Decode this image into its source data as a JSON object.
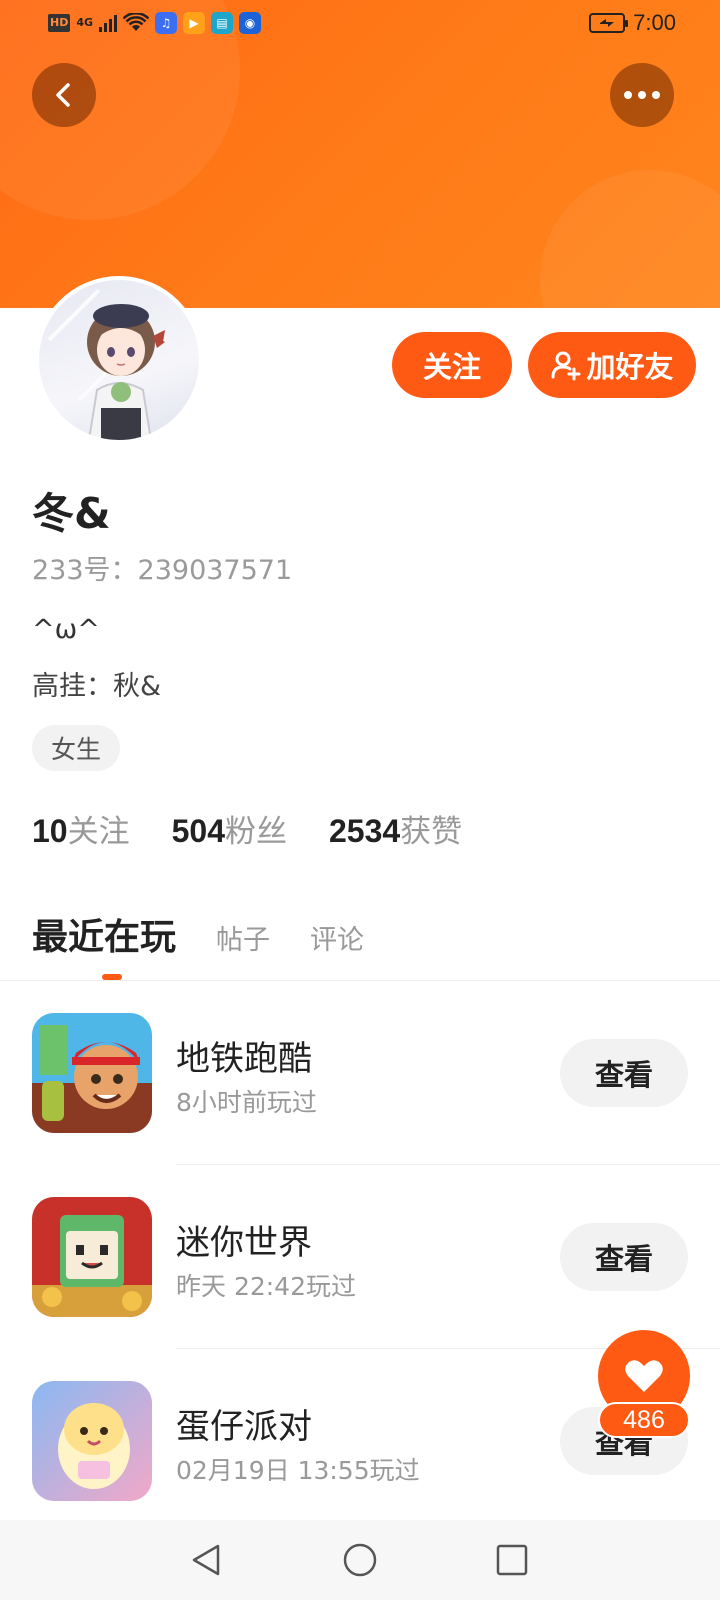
{
  "statusbar": {
    "network": "4G",
    "time": "7:00"
  },
  "profile": {
    "name": "冬&",
    "id_text": "233号：239037571",
    "bio_line1": "^ω^",
    "bio_line2": "高挂：秋&",
    "gender": "女生"
  },
  "actions": {
    "follow_label": "关注",
    "add_friend_label": "加好友"
  },
  "stats": [
    {
      "num": "10",
      "label": "关注"
    },
    {
      "num": "504",
      "label": "粉丝"
    },
    {
      "num": "2534",
      "label": "获赞"
    }
  ],
  "tabs": [
    {
      "label": "最近在玩",
      "active": true
    },
    {
      "label": "帖子",
      "active": false
    },
    {
      "label": "评论",
      "active": false
    }
  ],
  "games": [
    {
      "name": "地铁跑酷",
      "time": "8小时前玩过",
      "button": "查看"
    },
    {
      "name": "迷你世界",
      "time": "昨天 22:42玩过",
      "button": "查看"
    },
    {
      "name": "蛋仔派对",
      "time": "02月19日 13:55玩过",
      "button": "查看"
    }
  ],
  "like": {
    "count": "486"
  },
  "colors": {
    "accent": "#ff5a14",
    "banner": "#ff7a18"
  }
}
